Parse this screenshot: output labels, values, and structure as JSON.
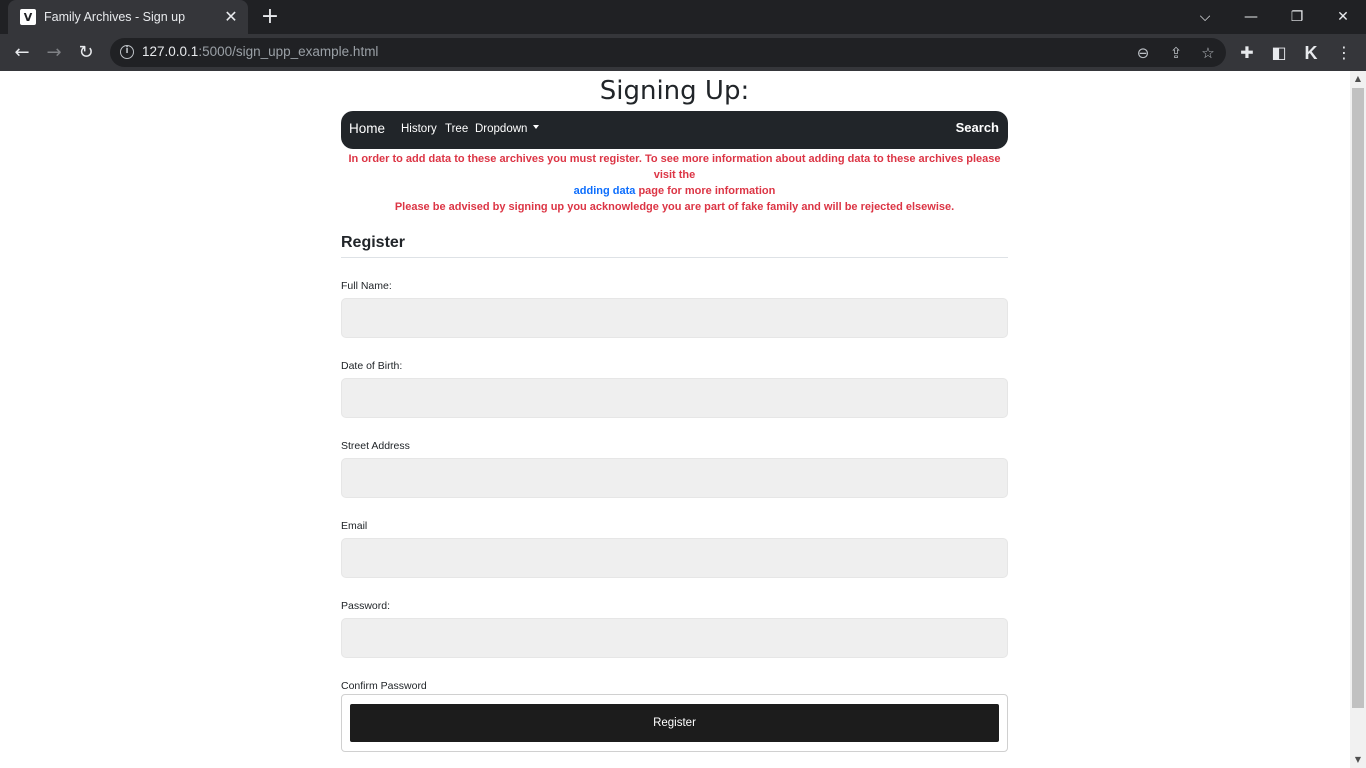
{
  "browser": {
    "tab_title": "Family Archives - Sign up",
    "tab_close": "✕",
    "new_tab": "+",
    "url_host": "127.0.0.1",
    "url_rest": ":5000/sign_upp_example.html"
  },
  "page": {
    "title": "Signing Up:"
  },
  "navbar": {
    "brand": "Home",
    "links": [
      "History",
      "Tree",
      "Dropdown"
    ],
    "search": "Search",
    "bg_color": "#212529"
  },
  "notice": {
    "line1": "In order to add data to these archives you must register. To see more information about adding data to these archives please visit the",
    "link": "adding data",
    "line2_rest": "page for more information",
    "line3": "Please be advised by signing up you acknowledge you are part of fake family and will be rejected elsewise.",
    "color": "#dc3545",
    "link_color": "#0d6efd"
  },
  "form": {
    "heading": "Register",
    "fields": [
      {
        "label": "Full Name:",
        "value": ""
      },
      {
        "label": "Date of Birth:",
        "value": ""
      },
      {
        "label": "Street Address",
        "value": ""
      },
      {
        "label": "Email",
        "value": ""
      },
      {
        "label": "Password:",
        "value": ""
      },
      {
        "label": "Confirm Password",
        "value": ""
      }
    ],
    "submit_label": "Register"
  }
}
